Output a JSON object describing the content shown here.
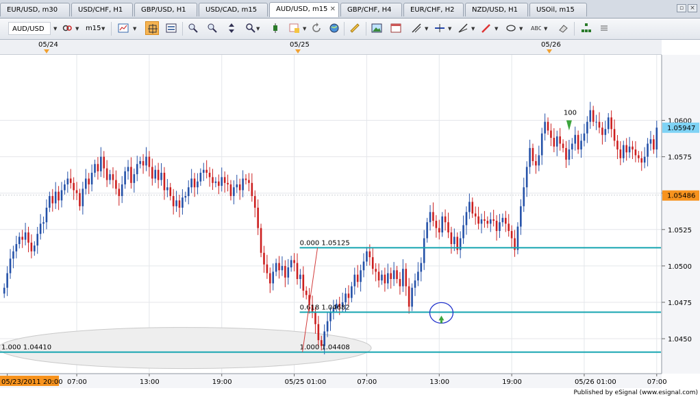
{
  "tabs": [
    {
      "label": "EUR/USD, m30",
      "active": false
    },
    {
      "label": "USD/CHF, H1",
      "active": false
    },
    {
      "label": "GBP/USD, H1",
      "active": false
    },
    {
      "label": "USD/CAD, m15",
      "active": false
    },
    {
      "label": "AUD/USD, m15",
      "active": true
    },
    {
      "label": "GBP/CHF, H4",
      "active": false
    },
    {
      "label": "EUR/CHF, H2",
      "active": false
    },
    {
      "label": "NZD/USD, H1",
      "active": false
    },
    {
      "label": "USOil, m15",
      "active": false
    }
  ],
  "tab_close_glyph": "✕",
  "toolbar": {
    "symbol": "AUD/USD",
    "interval": "m15"
  },
  "date_markers": [
    "05/24",
    "05/25",
    "05/26"
  ],
  "chart_data": {
    "type": "candlestick",
    "symbol": "AUD/USD",
    "interval": "m15",
    "y_ticks": [
      "1.0600",
      "1.0575",
      "1.0550",
      "1.0525",
      "1.0500",
      "1.0475",
      "1.0450"
    ],
    "y_tick_values": [
      1.06,
      1.0575,
      1.055,
      1.0525,
      1.05,
      1.0475,
      1.045
    ],
    "ylim": [
      1.0426,
      1.0645
    ],
    "x_ticks": [
      "05/23/2011 20:00",
      "07:00",
      "13:00",
      "19:00",
      "05/25 01:00",
      "07:00",
      "13:00",
      "19:00",
      "05/26 01:00",
      "07:00"
    ],
    "x_tick_indices": [
      1,
      24,
      48,
      72,
      96,
      120,
      144,
      168,
      192,
      216
    ],
    "grid": true,
    "current_price": {
      "label": "1.05947",
      "value": 1.05947
    },
    "reference_price": {
      "label": "1.05486",
      "value": 1.05486
    },
    "fib_levels": [
      {
        "label": "0.000 1.05125",
        "value": 1.05125
      },
      {
        "label": "0.618 1.04682",
        "value": 1.04682
      },
      {
        "label": "1.000 1.04408",
        "value": 1.04408
      }
    ],
    "left_level_label": "1.000 1.04410",
    "annotation": "100",
    "closes": [
      1.0485,
      1.0495,
      1.0505,
      1.051,
      1.0515,
      1.052,
      1.0518,
      1.0523,
      1.0516,
      1.051,
      1.0514,
      1.0522,
      1.0529,
      1.053,
      1.054,
      1.0548,
      1.0543,
      1.0551,
      1.0545,
      1.0552,
      1.0556,
      1.056,
      1.0557,
      1.0552,
      1.055,
      1.0541,
      1.0553,
      1.056,
      1.0556,
      1.0564,
      1.057,
      1.0565,
      1.0575,
      1.0567,
      1.0559,
      1.0563,
      1.0559,
      1.0553,
      1.0548,
      1.0556,
      1.0565,
      1.0568,
      1.0557,
      1.0563,
      1.057,
      1.0572,
      1.0569,
      1.0575,
      1.0568,
      1.056,
      1.0566,
      1.0559,
      1.0564,
      1.0552,
      1.0554,
      1.0548,
      1.0541,
      1.0545,
      1.054,
      1.0547,
      1.0548,
      1.0554,
      1.056,
      1.0554,
      1.0558,
      1.0564,
      1.0566,
      1.0564,
      1.0561,
      1.0557,
      1.0558,
      1.0555,
      1.0561,
      1.0557,
      1.0556,
      1.0548,
      1.0554,
      1.0556,
      1.0552,
      1.056,
      1.0559,
      1.0557,
      1.0548,
      1.054,
      1.0526,
      1.0509,
      1.0501,
      1.0495,
      1.0488,
      1.0496,
      1.0502,
      1.0497,
      1.05,
      1.0492,
      1.0499,
      1.0504,
      1.0502,
      1.0491,
      1.0494,
      1.0483,
      1.048,
      1.0473,
      1.0468,
      1.046,
      1.0449,
      1.0445,
      1.0455,
      1.0462,
      1.0468,
      1.0471,
      1.0474,
      1.0472,
      1.0475,
      1.0481,
      1.0478,
      1.0486,
      1.0494,
      1.0489,
      1.0497,
      1.0503,
      1.051,
      1.0506,
      1.0498,
      1.0496,
      1.049,
      1.0494,
      1.0488,
      1.0495,
      1.0491,
      1.0497,
      1.0491,
      1.0486,
      1.0498,
      1.0486,
      1.0472,
      1.0485,
      1.049,
      1.0496,
      1.0502,
      1.0519,
      1.053,
      1.0537,
      1.0531,
      1.0526,
      1.0523,
      1.0534,
      1.053,
      1.0523,
      1.0515,
      1.052,
      1.0511,
      1.0519,
      1.0528,
      1.0537,
      1.0544,
      1.0536,
      1.0534,
      1.0529,
      1.0532,
      1.0531,
      1.0529,
      1.0532,
      1.0531,
      1.0524,
      1.053,
      1.0533,
      1.0529,
      1.0524,
      1.0519,
      1.0511,
      1.0527,
      1.0541,
      1.0554,
      1.0568,
      1.0581,
      1.0572,
      1.0569,
      1.0576,
      1.0591,
      1.0599,
      1.0593,
      1.0588,
      1.0582,
      1.0589,
      1.0584,
      1.0581,
      1.0573,
      1.058,
      1.0584,
      1.059,
      1.058,
      1.0586,
      1.0591,
      1.0599,
      1.0607,
      1.0599,
      1.0599,
      1.0595,
      1.059,
      1.0594,
      1.0602,
      1.0594,
      1.0586,
      1.058,
      1.0574,
      1.0583,
      1.0578,
      1.0582,
      1.058,
      1.0576,
      1.0574,
      1.0571,
      1.0575,
      1.0584,
      1.0587,
      1.058,
      1.0595
    ]
  },
  "footer": {
    "credit": "Published by eSignal (www.esignal.com)"
  }
}
